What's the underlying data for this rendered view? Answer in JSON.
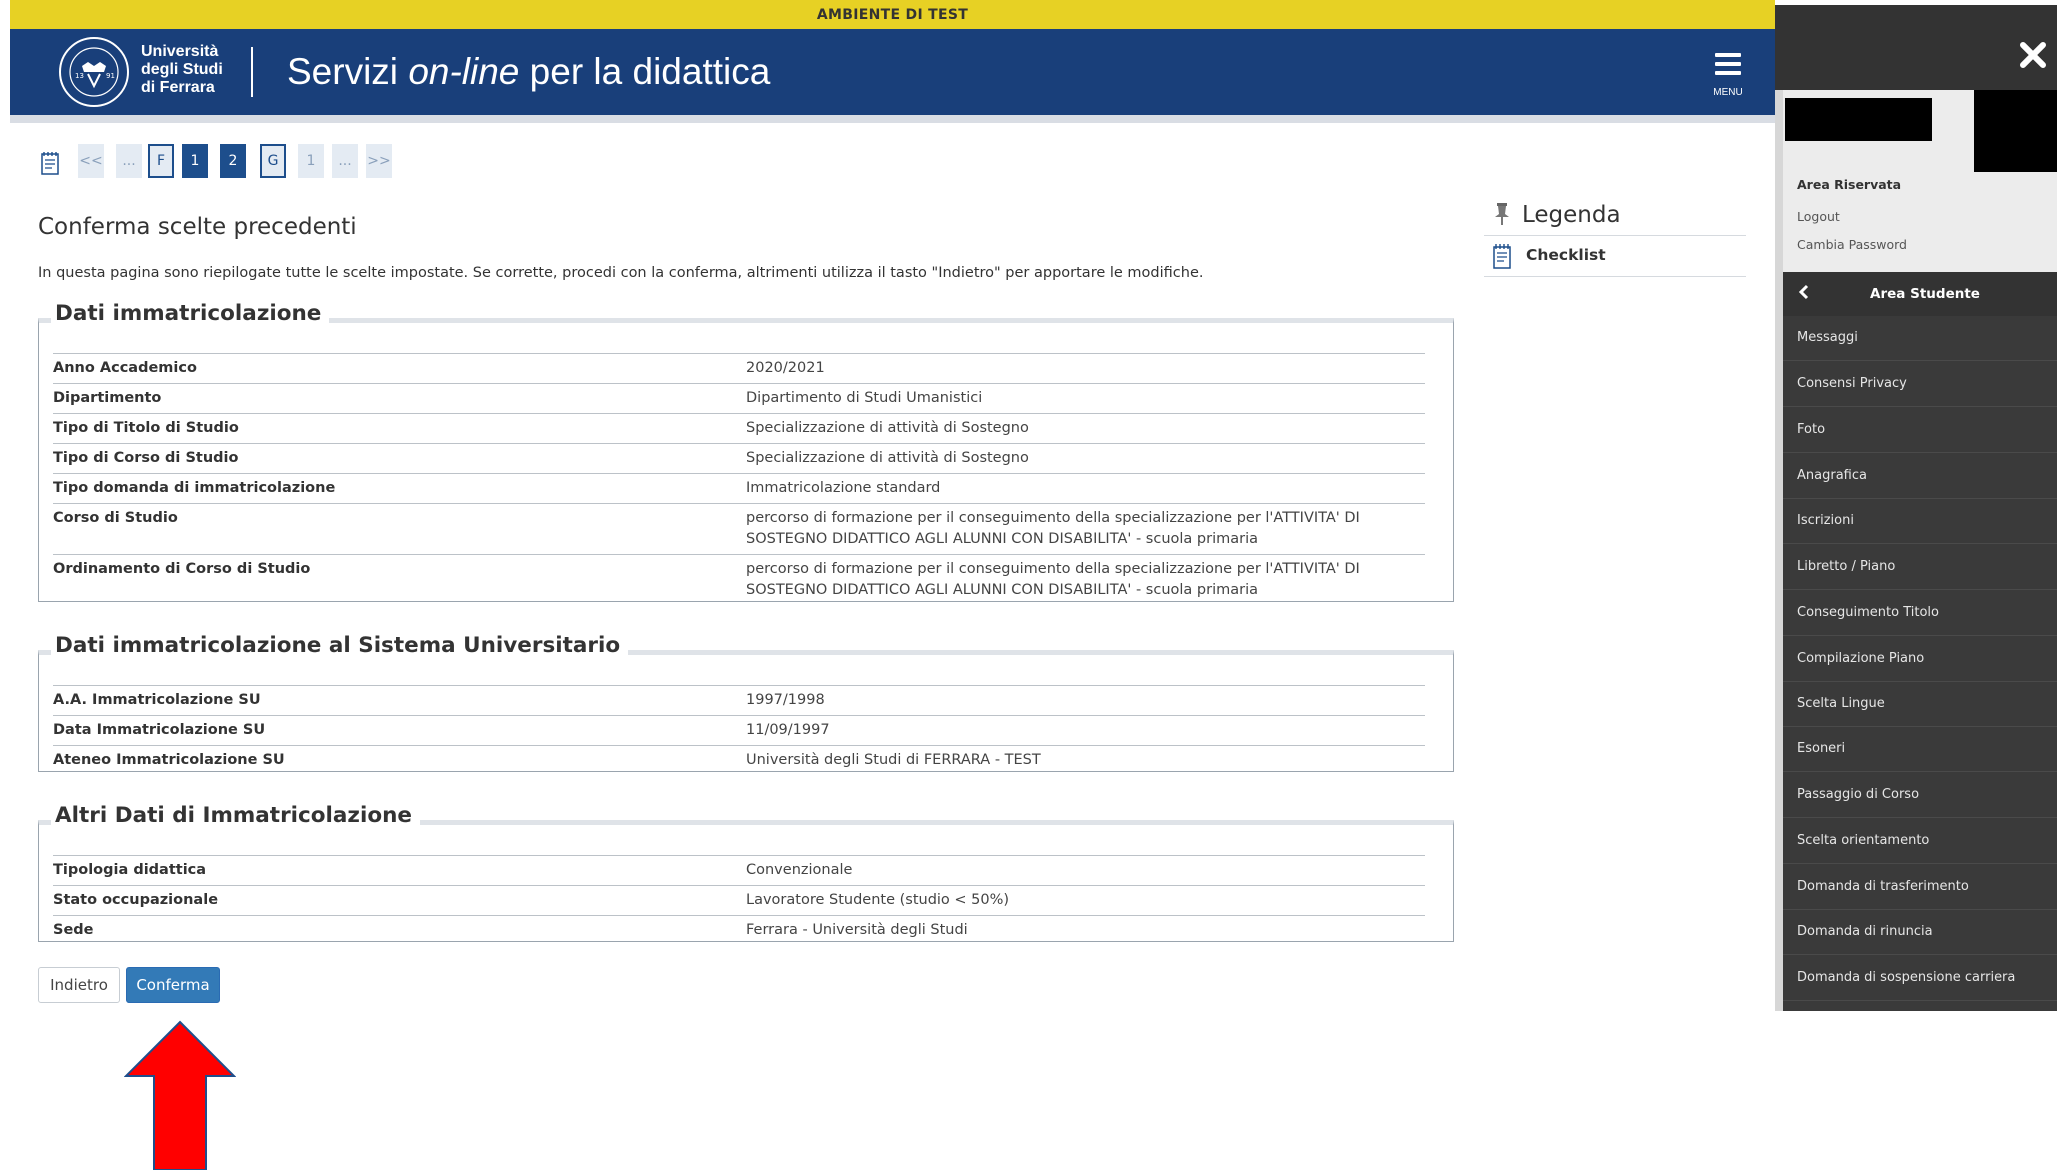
{
  "banner": "AMBIENTE DI TEST",
  "header": {
    "logo_line1": "Università",
    "logo_line2": "degli Studi",
    "logo_line3": "di Ferrara",
    "title_part1": "Servizi ",
    "title_italic": "on-line",
    "title_part2": " per la didattica",
    "menu_label": "MENU"
  },
  "pager": {
    "items": [
      "<<",
      "...",
      "F",
      "1",
      "2",
      "G",
      "1",
      "...",
      ">>"
    ]
  },
  "main": {
    "title": "Conferma scelte precedenti",
    "intro": "In questa pagina sono riepilogate tutte le scelte impostate. Se corrette, procedi con la conferma, altrimenti utilizza il tasto \"Indietro\" per apportare le modifiche."
  },
  "sections": [
    {
      "legend": "Dati immatricolazione",
      "rows": [
        {
          "k": "Anno Accademico",
          "v": "2020/2021"
        },
        {
          "k": "Dipartimento",
          "v": "Dipartimento di Studi Umanistici"
        },
        {
          "k": "Tipo di Titolo di Studio",
          "v": "Specializzazione di attività di Sostegno"
        },
        {
          "k": "Tipo di Corso di Studio",
          "v": "Specializzazione di attività di Sostegno"
        },
        {
          "k": "Tipo domanda di immatricolazione",
          "v": "Immatricolazione standard"
        },
        {
          "k": "Corso di Studio",
          "v": "percorso di formazione per il conseguimento della specializzazione per l'ATTIVITA' DI SOSTEGNO DIDATTICO AGLI ALUNNI CON DISABILITA' - scuola primaria"
        },
        {
          "k": "Ordinamento di Corso di Studio",
          "v": "percorso di formazione per il conseguimento della specializzazione per l'ATTIVITA' DI SOSTEGNO DIDATTICO AGLI ALUNNI CON DISABILITA' - scuola primaria"
        }
      ]
    },
    {
      "legend": "Dati immatricolazione al Sistema Universitario",
      "rows": [
        {
          "k": "A.A. Immatricolazione SU",
          "v": "1997/1998"
        },
        {
          "k": "Data Immatricolazione SU",
          "v": "11/09/1997"
        },
        {
          "k": "Ateneo Immatricolazione SU",
          "v": "Università degli Studi di FERRARA - TEST"
        }
      ]
    },
    {
      "legend": "Altri Dati di Immatricolazione",
      "rows": [
        {
          "k": "Tipologia didattica",
          "v": "Convenzionale"
        },
        {
          "k": "Stato occupazionale",
          "v": "Lavoratore Studente (studio < 50%)"
        },
        {
          "k": "Sede",
          "v": "Ferrara - Università degli Studi"
        }
      ]
    }
  ],
  "buttons": {
    "back": "Indietro",
    "confirm": "Conferma"
  },
  "legend_box": {
    "title": "Legenda",
    "checklist": "Checklist"
  },
  "side": {
    "reserved_title": "Area Riservata",
    "logout": "Logout",
    "change_password": "Cambia Password",
    "menu_title": "Area Studente",
    "items": [
      "Messaggi",
      "Consensi Privacy",
      "Foto",
      "Anagrafica",
      "Iscrizioni",
      "Libretto / Piano",
      "Conseguimento Titolo",
      "Compilazione Piano",
      "Scelta Lingue",
      "Esoneri",
      "Passaggio di Corso",
      "Scelta orientamento",
      "Domanda di trasferimento",
      "Domanda di rinuncia",
      "Domanda di sospensione carriera"
    ]
  },
  "colors": {
    "header_blue": "#193f7a",
    "banner_yellow": "#e7d124",
    "confirm_blue": "#337ab7",
    "arrow_red": "#ff0000",
    "side_dark": "#3a3a3a"
  }
}
